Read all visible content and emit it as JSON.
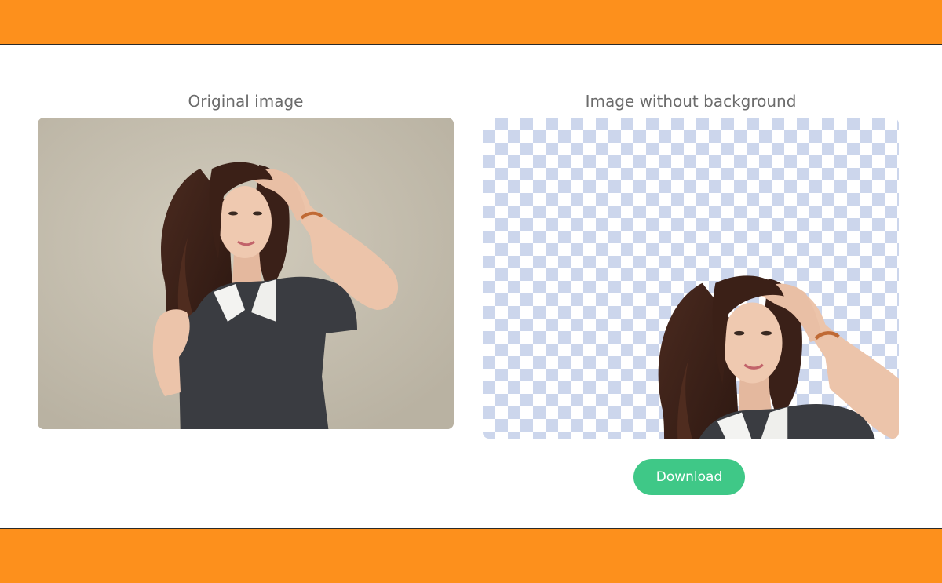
{
  "colors": {
    "header_bar": "#fd901c",
    "footer_bar": "#fd901c",
    "download_button": "#3fc887",
    "checker": "#ccd6ec",
    "photo_backdrop": "#c7c1b2"
  },
  "panels": {
    "original": {
      "title": "Original image",
      "image": "woman-portrait-photo"
    },
    "result": {
      "title": "Image without background",
      "image": "woman-portrait-cutout-on-transparency-grid"
    }
  },
  "actions": {
    "download_label": "Download"
  }
}
